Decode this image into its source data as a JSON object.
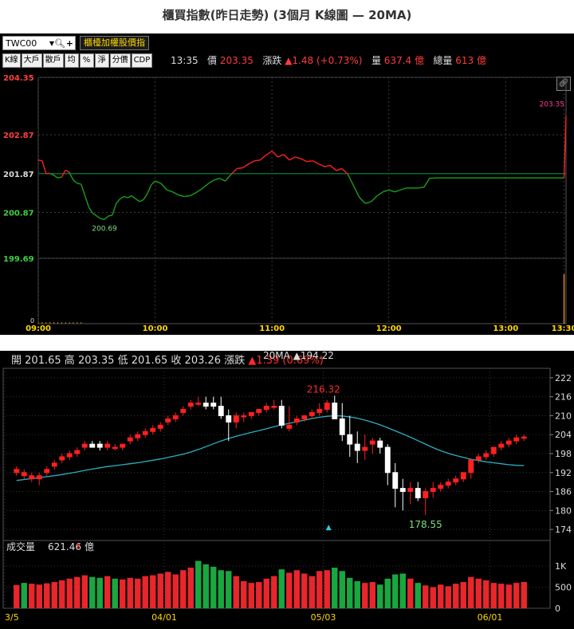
{
  "page": {
    "title": "櫃買指數(昨日走勢) (3個月 K線圖 — 20MA)"
  },
  "intraday": {
    "symbol": "TWC00",
    "mode_button": "櫃檯加權股價指",
    "tool_buttons": [
      "K線",
      "大戶",
      "散戶",
      "均",
      "%",
      "淨",
      "分價",
      "CDP"
    ],
    "quote": {
      "time": "13:35",
      "price_label": "價",
      "price": "203.35",
      "change_label": "漲跌",
      "change": "▲1.48 (+0.73%)",
      "volume_label": "量",
      "volume": "637.4 億",
      "total_label": "總量",
      "total": "613 億"
    },
    "icons": {
      "link": "link-icon",
      "search": "search-icon",
      "add": "plus-icon",
      "dropdown": "chevron-down-icon"
    },
    "colors": {
      "up": "#ff2020",
      "down": "#1aa01a",
      "ref": "#0a8a3a",
      "high": "#ff2a2a",
      "low": "#35c235",
      "grid": "#3a3a3a"
    }
  },
  "kchart": {
    "summary": {
      "open_label": "開",
      "open": "201.65",
      "high_label": "高",
      "high": "203.35",
      "low_label": "低",
      "low": "201.65",
      "close_label": "收",
      "close": "203.26",
      "change_label": "漲跌",
      "change": "▲1.39 (0.69%)"
    },
    "ma_label": "20MA ▲194.22",
    "volume_label": "成交量",
    "volume_value": "621.46",
    "volume_unit": "億",
    "colors": {
      "up": "#ff2020",
      "down_body": "#ffffff",
      "ma": "#2ab0c0",
      "vol_up": "#e8262b",
      "vol_down": "#1aa640"
    }
  },
  "chart_data": [
    {
      "type": "line",
      "name": "intraday",
      "x_ticks": [
        "09:00",
        "10:00",
        "11:00",
        "12:00",
        "13:00",
        "13:30"
      ],
      "y_ticks": [
        "204.35",
        "202.87",
        "201.87",
        "200.87",
        "199.69"
      ],
      "ylim": [
        199.69,
        204.35
      ],
      "reference": 201.87,
      "annotations": {
        "high": "203.35",
        "low": "200.69"
      },
      "x_minutes": [
        0,
        2,
        4,
        6,
        8,
        10,
        12,
        14,
        16,
        18,
        20,
        22,
        24,
        26,
        28,
        30,
        32,
        34,
        36,
        38,
        40,
        42,
        44,
        46,
        48,
        50,
        52,
        54,
        56,
        58,
        60,
        63,
        66,
        69,
        72,
        75,
        78,
        81,
        84,
        87,
        90,
        93,
        96,
        99,
        102,
        105,
        108,
        111,
        114,
        117,
        120,
        123,
        126,
        129,
        132,
        135,
        138,
        141,
        144,
        147,
        150,
        153,
        156,
        159,
        162,
        165,
        168,
        171,
        174,
        177,
        180,
        183,
        186,
        189,
        192,
        195,
        198,
        201,
        204,
        207,
        210,
        213,
        216,
        219,
        222,
        225,
        228,
        231,
        234,
        237,
        240,
        243,
        246,
        249,
        252,
        255,
        258,
        261,
        264,
        267,
        270,
        271
      ],
      "values": [
        202.22,
        202.2,
        201.87,
        201.88,
        201.83,
        201.76,
        201.78,
        201.96,
        201.9,
        201.7,
        201.62,
        201.6,
        201.3,
        201.0,
        200.85,
        200.78,
        200.71,
        200.69,
        200.78,
        200.8,
        201.1,
        201.22,
        201.28,
        201.25,
        201.3,
        201.22,
        201.15,
        201.2,
        201.35,
        201.58,
        201.68,
        201.62,
        201.45,
        201.4,
        201.32,
        201.28,
        201.3,
        201.38,
        201.48,
        201.6,
        201.7,
        201.75,
        201.68,
        201.85,
        202.0,
        202.02,
        202.12,
        202.2,
        202.22,
        202.35,
        202.45,
        202.3,
        202.36,
        202.22,
        202.3,
        202.25,
        202.18,
        202.2,
        202.12,
        202.05,
        202.08,
        201.95,
        202.0,
        201.85,
        201.55,
        201.25,
        201.1,
        201.15,
        201.3,
        201.4,
        201.45,
        201.4,
        201.45,
        201.5,
        201.5,
        201.5,
        201.52,
        201.75,
        201.76,
        201.76,
        201.76,
        201.76,
        201.76,
        201.76,
        201.76,
        201.76,
        201.76,
        201.76,
        201.76,
        201.76,
        201.76,
        201.76,
        201.76,
        201.76,
        201.76,
        201.76,
        201.76,
        201.76,
        201.76,
        201.76,
        201.76,
        203.35
      ]
    },
    {
      "type": "candlestick",
      "name": "3-month daily K line",
      "x_ticks": [
        "3/5",
        "04/01",
        "05/03",
        "06/01"
      ],
      "y_ticks": [
        222,
        216,
        210,
        204,
        198,
        192,
        186,
        180,
        174
      ],
      "ylim": [
        171,
        225
      ],
      "annotations": {
        "high": "216.32",
        "low": "178.55"
      },
      "open": [
        192,
        191,
        190,
        190,
        192,
        194,
        196,
        197,
        198,
        200,
        201,
        201,
        200,
        200,
        200,
        202,
        203,
        204,
        205,
        206,
        208,
        209,
        211,
        213,
        214,
        214,
        214,
        213,
        210,
        208,
        210,
        210,
        211,
        212,
        213,
        213,
        206,
        208,
        209,
        210,
        211,
        212,
        214,
        209,
        204,
        201,
        199,
        201,
        202,
        200,
        192,
        187,
        186,
        187,
        184,
        186,
        187,
        188,
        189,
        190,
        192,
        196,
        197,
        198,
        200,
        201,
        202,
        203
      ],
      "high": [
        194,
        193,
        192,
        192,
        194,
        196,
        198,
        199,
        200,
        202,
        202,
        202,
        202,
        201,
        201,
        204,
        205,
        206,
        207,
        208,
        210,
        211,
        213,
        215,
        216,
        216,
        216,
        216,
        212,
        211,
        211,
        211,
        212,
        214,
        215,
        215,
        213,
        210,
        210,
        212,
        214,
        215,
        216.32,
        214,
        210,
        205,
        204,
        203,
        203,
        201,
        195,
        190,
        189,
        189,
        187,
        189,
        189,
        190,
        191,
        192,
        195,
        198,
        199,
        200,
        202,
        203,
        204,
        204
      ],
      "low": [
        191,
        190,
        189,
        188,
        191,
        193,
        195,
        196,
        197,
        199,
        200,
        199,
        199,
        199,
        199,
        201,
        202,
        203,
        204,
        205,
        207,
        208,
        210,
        212,
        213,
        212,
        212,
        209,
        202,
        206,
        208,
        209,
        210,
        211,
        212,
        206,
        205,
        207,
        208,
        209,
        210,
        211,
        209,
        202,
        197,
        195,
        196,
        198,
        198,
        188,
        181,
        180,
        182,
        183,
        178.55,
        184,
        186,
        187,
        188,
        189,
        190,
        195,
        196,
        197,
        199,
        200,
        201,
        202
      ],
      "close": [
        193,
        192,
        191,
        191,
        193,
        195,
        197,
        198,
        199,
        201,
        200,
        200,
        201,
        200,
        201,
        203,
        204,
        205,
        206,
        207,
        209,
        210,
        212,
        214,
        214,
        213,
        213,
        210,
        208,
        210,
        210,
        211,
        212,
        213,
        213,
        207,
        207,
        209,
        210,
        211,
        212,
        214,
        209,
        204,
        201,
        199,
        200,
        202,
        200,
        192,
        187,
        186,
        187,
        184,
        186,
        187,
        188,
        189,
        190,
        192,
        196,
        197,
        198,
        200,
        201,
        202,
        203,
        203.26
      ],
      "ma20": [
        189.5,
        189.8,
        190.1,
        190.4,
        190.7,
        191.0,
        191.4,
        191.8,
        192.2,
        192.7,
        193.1,
        193.5,
        193.9,
        194.2,
        194.5,
        194.8,
        195.1,
        195.5,
        195.9,
        196.3,
        196.8,
        197.3,
        197.8,
        198.5,
        199.3,
        200.2,
        201.1,
        202.0,
        202.8,
        203.5,
        204.1,
        204.7,
        205.3,
        205.9,
        206.5,
        207.1,
        207.6,
        208.1,
        208.6,
        209.1,
        209.5,
        209.8,
        210.0,
        209.9,
        209.6,
        209.2,
        208.6,
        207.9,
        207.1,
        206.2,
        205.2,
        204.2,
        203.2,
        202.1,
        201.0,
        199.9,
        198.9,
        198.1,
        197.4,
        196.8,
        196.2,
        195.8,
        195.4,
        195.1,
        194.8,
        194.5,
        194.3,
        194.22
      ],
      "volume_y_ticks": [
        "1K",
        "500",
        "0"
      ],
      "volume_ylim": [
        0,
        1300
      ],
      "volume": [
        550,
        600,
        580,
        560,
        590,
        620,
        660,
        700,
        740,
        780,
        740,
        720,
        760,
        700,
        680,
        720,
        700,
        760,
        780,
        820,
        860,
        800,
        900,
        960,
        1120,
        1040,
        980,
        900,
        880,
        760,
        640,
        600,
        620,
        700,
        760,
        920,
        840,
        900,
        820,
        760,
        880,
        900,
        960,
        880,
        720,
        640,
        600,
        620,
        560,
        700,
        800,
        820,
        700,
        600,
        540,
        500,
        560,
        520,
        580,
        620,
        740,
        700,
        660,
        600,
        580,
        560,
        600,
        621.46
      ],
      "volume_up": [
        true,
        false,
        true,
        true,
        true,
        true,
        true,
        true,
        true,
        true,
        false,
        false,
        true,
        false,
        true,
        true,
        true,
        true,
        true,
        true,
        true,
        true,
        true,
        true,
        false,
        false,
        false,
        false,
        false,
        true,
        true,
        true,
        true,
        true,
        true,
        false,
        true,
        true,
        true,
        true,
        true,
        true,
        false,
        false,
        false,
        false,
        true,
        true,
        false,
        false,
        false,
        false,
        true,
        false,
        true,
        true,
        true,
        true,
        true,
        true,
        true,
        true,
        true,
        true,
        true,
        true,
        true,
        true
      ],
      "ma_marker": "▲"
    }
  ]
}
